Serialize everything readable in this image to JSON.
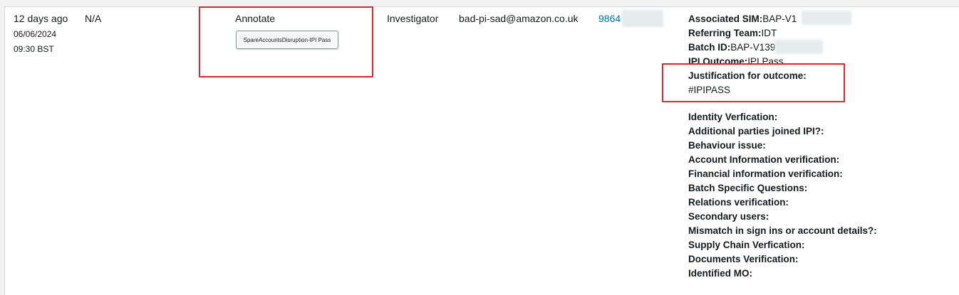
{
  "row": {
    "time_ago": "12 days ago",
    "date": "06/06/2024",
    "time": "09:30 BST",
    "value_na": "N/A",
    "action_type": "Annotate",
    "tag_button_label": "SpareAccountsDisruption-IPI Pass",
    "role": "Investigator",
    "email": "bad-pi-sad@amazon.co.uk",
    "phone_partial": "9864"
  },
  "details": {
    "associated_sim": {
      "key": "Associated SIM:",
      "value": "BAP-V1"
    },
    "referring_team": {
      "key": "Referring Team:",
      "value": "IDT"
    },
    "batch_id": {
      "key": "Batch ID:",
      "value": "BAP-V139"
    },
    "ipi_outcome": {
      "key": "IPI Outcome:",
      "value": "IPI Pass"
    },
    "justification": {
      "key": "Justification for outcome:",
      "value": "#IPIPASS"
    },
    "questions": [
      "Identity Verfication:",
      "Additional parties joined IPI?:",
      "Behaviour issue:",
      "Account Information verification:",
      "Financial information verification:",
      "Batch Specific Questions:",
      "Relations verification:",
      "Secondary users:",
      "Mismatch in sign ins or account details?:",
      "Supply Chain Verfication:",
      "Documents Verification:",
      "Identified MO:"
    ]
  },
  "colors": {
    "annotation_border": "#d9272e",
    "link": "#0073bb"
  }
}
